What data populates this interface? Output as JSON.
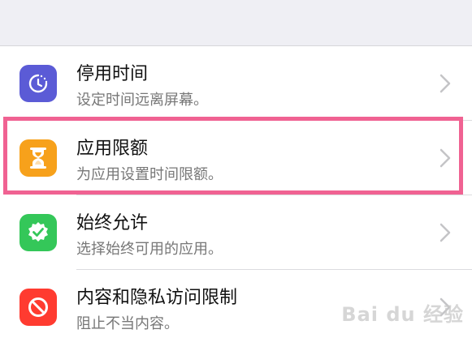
{
  "settings_list": {
    "items": [
      {
        "title": "停用时间",
        "subtitle": "设定时间远离屏幕。",
        "icon": "downtime-icon",
        "color": "#5b5bd6"
      },
      {
        "title": "应用限额",
        "subtitle": "为应用设置时间限额。",
        "icon": "hourglass-icon",
        "color": "#f7a11b"
      },
      {
        "title": "始终允许",
        "subtitle": "选择始终可用的应用。",
        "icon": "checkmark-badge-icon",
        "color": "#34c759"
      },
      {
        "title": "内容和隐私访问限制",
        "subtitle": "阻止不当内容。",
        "icon": "restriction-icon",
        "color": "#ff3b30"
      }
    ]
  },
  "highlight_color": "#f06292",
  "watermark": {
    "text": "Bai du 经验"
  }
}
